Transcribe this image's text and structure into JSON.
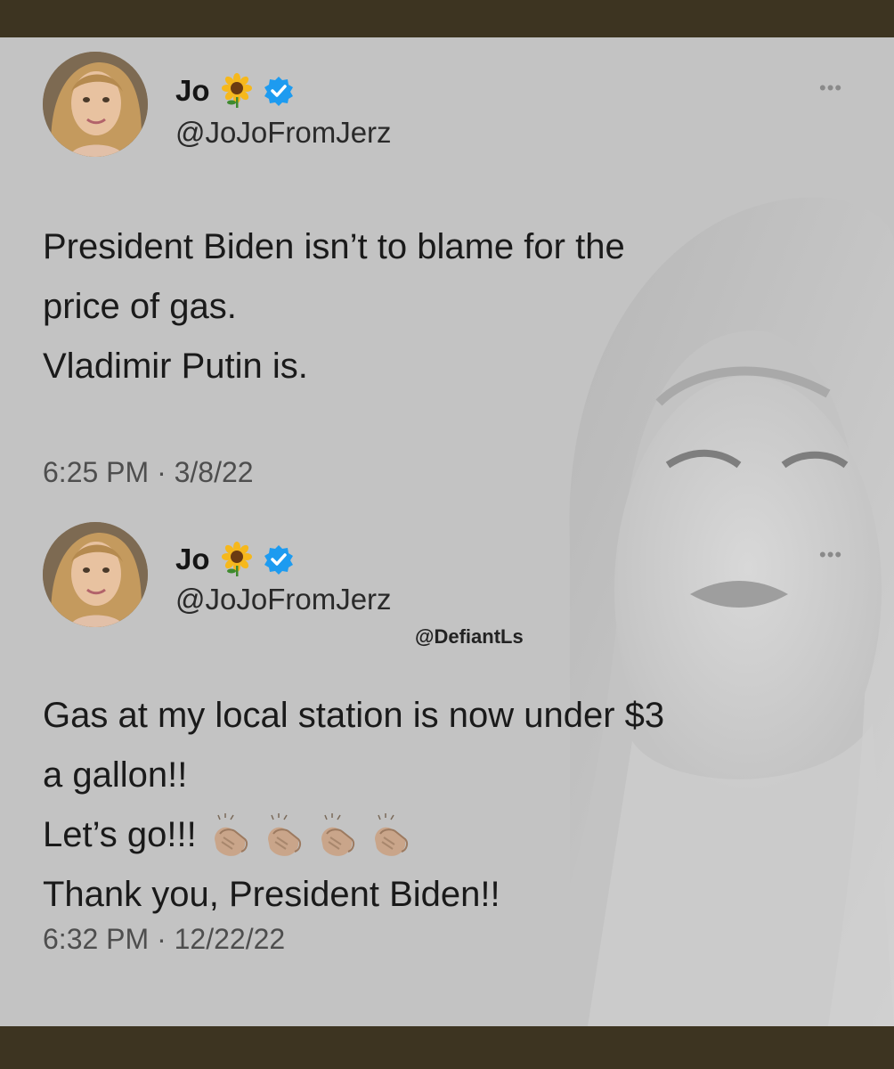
{
  "tweets": [
    {
      "name": "Jo",
      "name_emoji": "sunflower-emoji",
      "verified_icon": "verified-badge-icon",
      "handle": "@JoJoFromJerz",
      "more_icon": "more-options-icon",
      "lines": [
        "President Biden isn’t to blame for the",
        "price of gas.",
        "Vladimir Putin is."
      ],
      "timestamp": "6:25 PM · 3/8/22"
    },
    {
      "name": "Jo",
      "name_emoji": "sunflower-emoji",
      "verified_icon": "verified-badge-icon",
      "handle": "@JoJoFromJerz",
      "more_icon": "more-options-icon",
      "lines": [
        "Gas at my local station is now under $3",
        "a gallon!!",
        "Let’s go!!!",
        "Thank you, President Biden!!"
      ],
      "clap_emoji_count": 4,
      "timestamp": "6:32 PM · 12/22/22"
    }
  ],
  "watermark": "@DefiantLs",
  "colors": {
    "card_background": "#c3c3c3",
    "frame": "#3d3421",
    "verified_blue": "#1d9bf0",
    "text": "#1a1a1a"
  }
}
